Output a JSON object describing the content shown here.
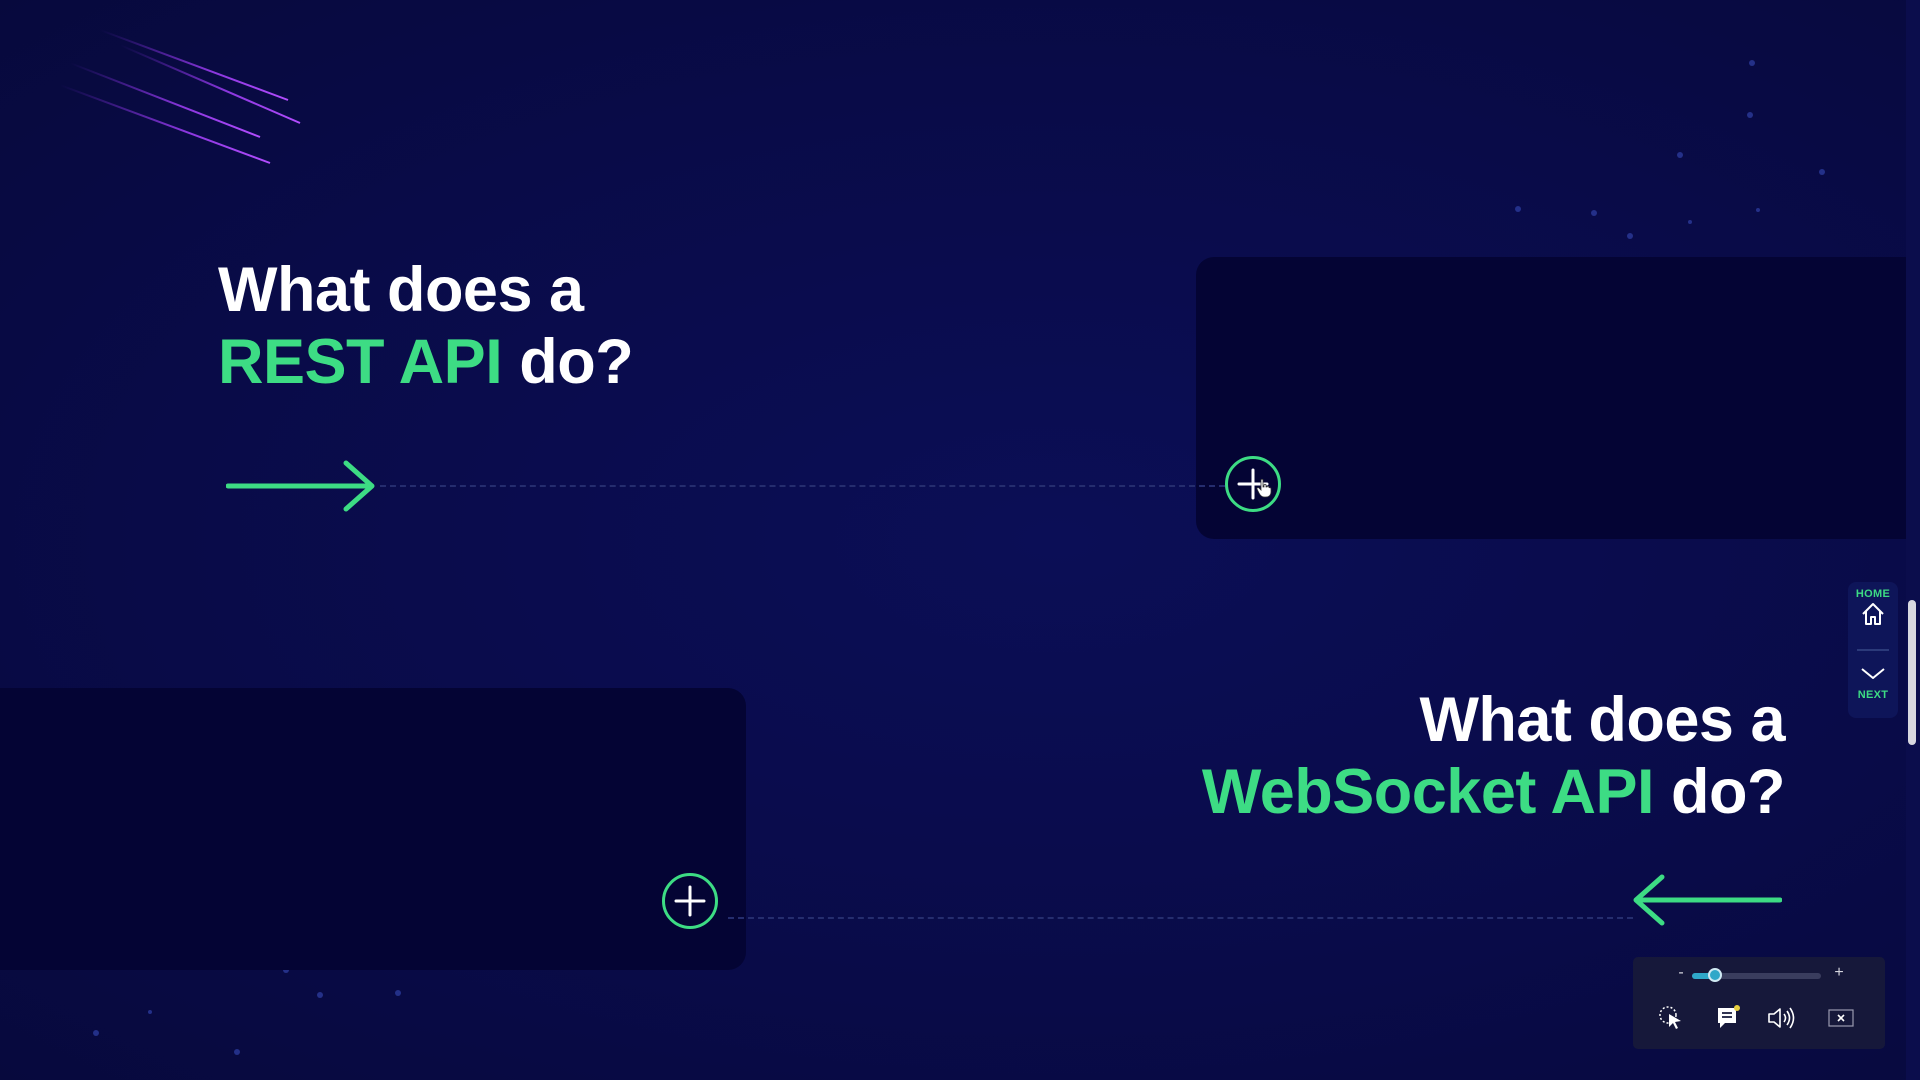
{
  "colors": {
    "background": "#0a0c4a",
    "accent": "#3ddc84",
    "card": "#040434",
    "heading_text": "#ffffff"
  },
  "rest_section": {
    "heading_line1": "What does a",
    "heading_accent": "REST API",
    "heading_tail": "do?",
    "arrow_icon": "arrow-right-icon",
    "expand_icon": "plus-circle-icon"
  },
  "websocket_section": {
    "heading_line1": "What does a",
    "heading_accent": "WebSocket API",
    "heading_tail": "do?",
    "arrow_icon": "arrow-left-icon",
    "expand_icon": "plus-circle-icon"
  },
  "side_nav": {
    "home_label": "HOME",
    "home_icon": "home-icon",
    "next_label": "NEXT",
    "next_icon": "chevron-down-icon"
  },
  "player_controls": {
    "zoom_minus": "-",
    "zoom_plus": "+",
    "zoom_level": 0.18,
    "icons": [
      "cursor-icon",
      "captions-icon",
      "audio-icon",
      "close-icon"
    ]
  }
}
